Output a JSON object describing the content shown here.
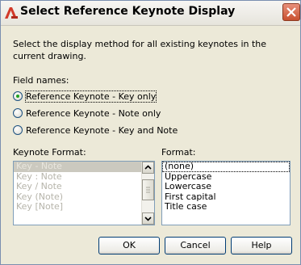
{
  "window": {
    "title": "Select Reference Keynote Display"
  },
  "description": "Select the display method for all existing keynotes in the current drawing.",
  "field_names": {
    "label": "Field names:",
    "options": [
      {
        "label": "Reference Keynote - Key only",
        "checked": true
      },
      {
        "label": "Reference Keynote - Note only",
        "checked": false
      },
      {
        "label": "Reference Keynote - Key and Note",
        "checked": false
      }
    ]
  },
  "keynote_format": {
    "label": "Keynote Format:",
    "items": [
      "Key - Note",
      "Key : Note",
      "Key / Note",
      "Key (Note)",
      "Key [Note]"
    ],
    "selected_index": 0
  },
  "format": {
    "label": "Format:",
    "items": [
      "(none)",
      "Uppercase",
      "Lowercase",
      "First capital",
      "Title case"
    ],
    "selected_index": 0
  },
  "buttons": {
    "ok": "OK",
    "cancel": "Cancel",
    "help": "Help"
  },
  "icons": {
    "app": "autodesk-a-icon",
    "close": "close-icon"
  },
  "colors": {
    "dialog_bg": "#ece9d8",
    "close_button": "#c8502f",
    "radio_dot": "#21a121"
  }
}
